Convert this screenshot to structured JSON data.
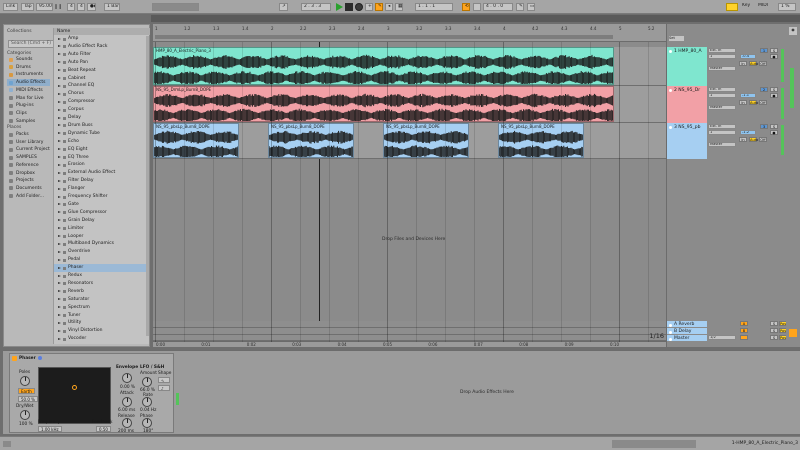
{
  "transport": {
    "link": "Link",
    "tap": "Tap",
    "tempo": "95.00",
    "sig_num": "4",
    "sig_den": "4",
    "quantize": "1 Bar",
    "arr_pos": "2 . 3 . 3",
    "loop_start": "1 . 1 . 1",
    "loop_len": "4 . 0 . 0",
    "key": "Key",
    "midi": "MIDI",
    "cpu": "1 %"
  },
  "browser": {
    "search_placeholder": "Search (Cmd + F)",
    "collections_label": "Collections",
    "categories_label": "Categories",
    "places_label": "Places",
    "name_header": "Name",
    "categories": [
      {
        "label": "Sounds",
        "color": "#e0a050"
      },
      {
        "label": "Drums",
        "color": "#d8a040"
      },
      {
        "label": "Instruments",
        "color": "#d89840"
      },
      {
        "label": "Audio Effects",
        "color": "#6fa3d0"
      },
      {
        "label": "MIDI Effects",
        "color": "#8fb0d0"
      },
      {
        "label": "Max for Live",
        "color": "#7f7f7f"
      },
      {
        "label": "Plug-ins",
        "color": "#7f7f7f"
      },
      {
        "label": "Clips",
        "color": "#7f7f7f"
      },
      {
        "label": "Samples",
        "color": "#7f7f7f"
      }
    ],
    "places": [
      "Packs",
      "User Library",
      "Current Project",
      "SAMPLES",
      "Reference",
      "Dropbox",
      "Projects",
      "Documents",
      "Add Folder..."
    ],
    "effects": [
      "Amp",
      "Audio Effect Rack",
      "Auto Filter",
      "Auto Pan",
      "Beat Repeat",
      "Cabinet",
      "Channel EQ",
      "Chorus",
      "Compressor",
      "Corpus",
      "Delay",
      "Drum Buss",
      "Dynamic Tube",
      "Echo",
      "EQ Eight",
      "EQ Three",
      "Erosion",
      "External Audio Effect",
      "Filter Delay",
      "Flanger",
      "Frequency Shifter",
      "Gate",
      "Glue Compressor",
      "Grain Delay",
      "Limiter",
      "Looper",
      "Multiband Dynamics",
      "Overdrive",
      "Pedal",
      "Phaser",
      "Redux",
      "Resonators",
      "Reverb",
      "Saturator",
      "Spectrum",
      "Tuner",
      "Utility",
      "Vinyl Distortion",
      "Vocoder"
    ],
    "selected_effect": "Phaser",
    "selected_category": "Audio Effects"
  },
  "arrangement": {
    "ruler_ticks": [
      "1",
      "1.2",
      "1.3",
      "1.4",
      "2",
      "2.2",
      "2.3",
      "2.4",
      "3",
      "3.2",
      "3.3",
      "3.4",
      "4",
      "4.2",
      "4.3",
      "4.4",
      "5",
      "5.2"
    ],
    "time_ticks": [
      "0:00",
      "0:01",
      "0:02",
      "0:03",
      "0:04",
      "0:05",
      "0:06",
      "0:07",
      "0:08",
      "0:09",
      "0:10"
    ],
    "zoom": "1/16",
    "drop_text": "Drop Files and Devices Here",
    "clip1_name": "HMP_80_A_Electric_Piano_3",
    "clip2_name": "NS_95_DrmLp_Burn8_DOPE",
    "clip3_name": "NS_95_pbsLp_Burn8_DOPE"
  },
  "tracks": [
    {
      "name": "1 HMP_80_A",
      "color": "#7fe6cf",
      "input": "Ext. In",
      "ch": "1",
      "monitor": "Master",
      "vol": "-0.4",
      "num": "1"
    },
    {
      "name": "2 NS_95_Dr",
      "color": "#f2a0a6",
      "input": "Ext. In",
      "ch": "1",
      "monitor": "Master",
      "vol": "-1.1",
      "num": "2"
    },
    {
      "name": "3 NS_95_pb",
      "color": "#a6cff2",
      "input": "Ext. In",
      "ch": "1",
      "monitor": "Master",
      "vol": "-1.2",
      "num": "3"
    }
  ],
  "returns": [
    {
      "name": "A Reverb",
      "letter": "A",
      "color": "#a6cff2"
    },
    {
      "name": "B Delay",
      "letter": "B",
      "color": "#a6cff2"
    },
    {
      "name": "Master",
      "letter": "",
      "color": "#a6cff2"
    }
  ],
  "master_tempo": "1/2",
  "device": {
    "name": "Phaser",
    "poles_label": "Poles",
    "poles_value": "4",
    "mode_label": "Earth",
    "color_value": "50.0 %",
    "drywet_label": "Dry/Wet",
    "drywet_value": "100 %",
    "freq_label": "Frequency",
    "freq_value": "1.00 kHz",
    "feedback_label": "Feedback",
    "feedback_value": "0.50",
    "envelope_label": "Envelope",
    "env_amount": "0.00 %",
    "attack_label": "Attack",
    "attack_value": "6.00 ms",
    "release_label": "Release",
    "release_value": "200 ms",
    "lfo_label": "LFO / S&H",
    "amount_label": "Amount",
    "amount_value": "66.0 %",
    "rate_label": "Rate",
    "rate_value": "0.04 Hz",
    "phase_label": "Phase",
    "phase_value": "180°",
    "shape_label": "Shape",
    "drop_text": "Drop Audio Effects Here"
  },
  "status": {
    "right_text": "1-HMP_80_A_Electric_Piano_3"
  },
  "colors": {
    "accent": "#ffa41c",
    "clip1": "#7fe6cf",
    "clip2": "#f2a0a6",
    "clip3": "#a6cff2",
    "selection": "#9bb9d6"
  }
}
